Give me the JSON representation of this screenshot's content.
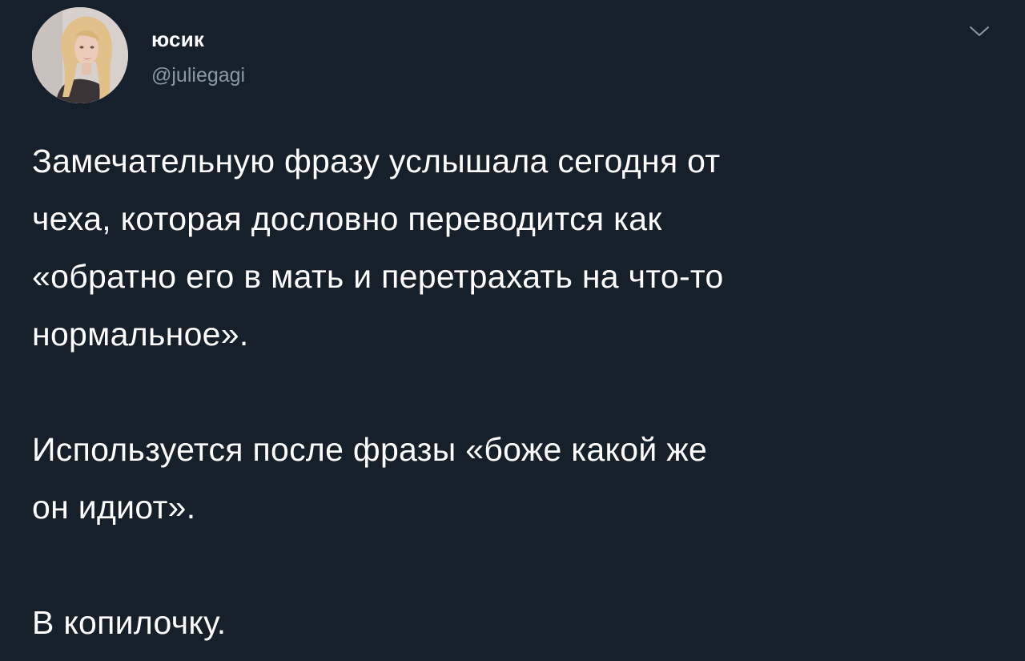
{
  "author": {
    "display_name": "юсик",
    "handle": "@juliegagi",
    "avatar_icon": "profile-photo-avatar"
  },
  "menu_icon": "chevron-down-icon",
  "tweet": {
    "paragraphs": [
      {
        "lines": [
          "Замечательную фразу услышала сегодня от",
          "чеха, которая дословно переводится как",
          "«обратно его в мать и перетрахать на что-то",
          "нормальное»."
        ]
      },
      {
        "lines": [
          "Используется после фразы «боже какой же",
          "он идиот»."
        ]
      },
      {
        "lines": [
          "В копилочку."
        ]
      }
    ]
  },
  "colors": {
    "background": "#15202b",
    "text_primary": "#ffffff",
    "text_secondary": "#8899a6"
  }
}
